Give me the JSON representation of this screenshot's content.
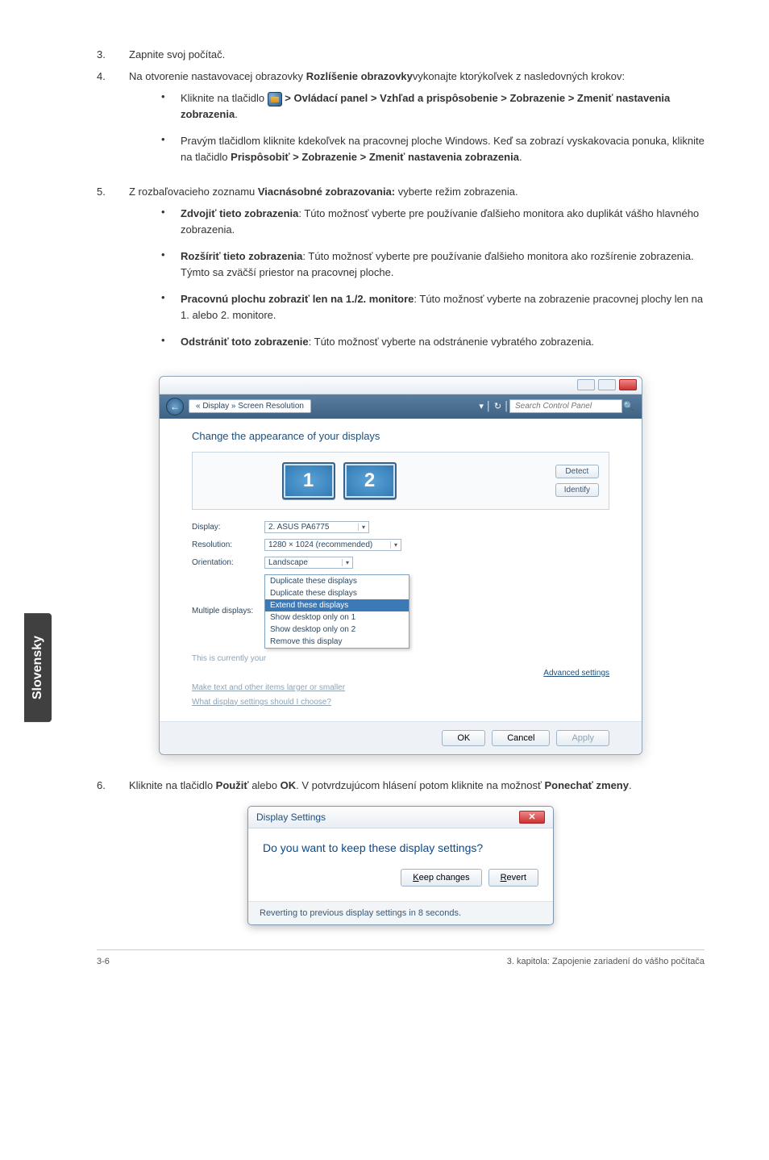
{
  "sideTab": "Slovensky",
  "steps": {
    "s3": {
      "num": "3.",
      "text": "Zapnite svoj počítač."
    },
    "s4": {
      "num": "4.",
      "intro_a": "Na otvorenie nastavovacej obrazovky ",
      "intro_b": "Rozlíšenie obrazovky",
      "intro_c": "vykonajte ktorýkoľvek z nasledovných krokov:",
      "bullets": [
        {
          "a": "Kliknite na tlačidlo ",
          "path": " > Ovládací panel > Vzhľad a prispôsobenie > Zobrazenie > Zmeniť nastavenia zobrazenia",
          "trail": "."
        },
        {
          "a": "Pravým tlačidlom kliknite kdekoľvek na pracovnej ploche Windows. Keď sa zobrazí vyskakovacia ponuka, kliknite na tlačidlo ",
          "path": "Prispôsobiť > Zobrazenie > Zmeniť nastavenia zobrazenia",
          "trail": "."
        }
      ]
    },
    "s5": {
      "num": "5.",
      "intro_a": "Z rozbaľovacieho zoznamu ",
      "intro_b": "Viacnásobné zobrazovania:",
      "intro_c": " vyberte režim zobrazenia.",
      "bullets": [
        {
          "title": "Zdvojiť tieto zobrazenia",
          "text": ": Túto možnosť vyberte pre používanie ďalšieho monitora ako duplikát vášho hlavného zobrazenia."
        },
        {
          "title": "Rozšíriť tieto zobrazenia",
          "text": ": Túto možnosť vyberte pre používanie ďalšieho monitora ako rozšírenie zobrazenia. Týmto sa zväčší priestor na pracovnej ploche."
        },
        {
          "title": "Pracovnú plochu zobraziť len na 1./2. monitore",
          "text": ": Túto možnosť vyberte na zobrazenie pracovnej plochy len na 1. alebo 2. monitore."
        },
        {
          "title": "Odstrániť toto zobrazenie",
          "text": ": Túto možnosť vyberte na odstránenie vybratého zobrazenia."
        }
      ]
    },
    "s6": {
      "num": "6.",
      "a": "Kliknite na tlačidlo ",
      "b": "Použiť",
      "c": " alebo ",
      "d": "OK",
      "e": ". V potvrdzujúcom hlásení potom kliknite na možnosť ",
      "f": "Ponechať zmeny",
      "g": "."
    }
  },
  "cp": {
    "crumb": "« Display » Screen Resolution",
    "searchPlaceholder": "Search Control Panel",
    "heading": "Change the appearance of your displays",
    "mon1": "1",
    "mon2": "2",
    "detect": "Detect",
    "identify": "Identify",
    "labels": {
      "display": "Display:",
      "resolution": "Resolution:",
      "orientation": "Orientation:",
      "multiple": "Multiple displays:"
    },
    "values": {
      "display": "2. ASUS PA6775",
      "resolution": "1280 × 1024 (recommended)",
      "orientation": "Landscape"
    },
    "dd": {
      "o1": "Duplicate these displays",
      "o2": "Duplicate these displays",
      "sel": "Extend these displays",
      "o3": "Show desktop only on 1",
      "o4": "Show desktop only on 2",
      "o5": "Remove this display"
    },
    "noteA": "This is currently your",
    "noteB": "Make text and other items larger or smaller",
    "noteC": "What display settings should I choose?",
    "advanced": "Advanced settings",
    "ok": "OK",
    "cancel": "Cancel",
    "apply": "Apply"
  },
  "confirm": {
    "title": "Display Settings",
    "closeX": "✕",
    "question": "Do you want to keep these display settings?",
    "keep": "Keep changes",
    "revert": "Revert",
    "footer": "Reverting to previous display settings in 8 seconds."
  },
  "footer": {
    "left": "3-6",
    "right": "3. kapitola: Zapojenie zariadení do vášho počítača"
  }
}
